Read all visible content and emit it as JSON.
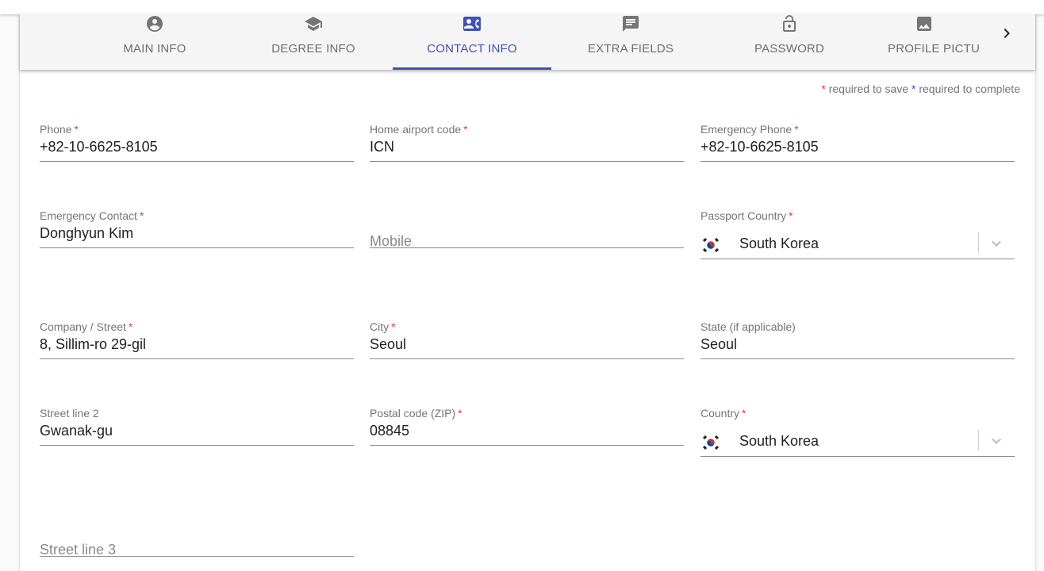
{
  "tabs": [
    {
      "label": "MAIN INFO",
      "icon": "account-circle-icon",
      "active": false
    },
    {
      "label": "DEGREE INFO",
      "icon": "school-icon",
      "active": false
    },
    {
      "label": "CONTACT INFO",
      "icon": "contact-card-icon",
      "active": true
    },
    {
      "label": "EXTRA FIELDS",
      "icon": "chat-message-icon",
      "active": false
    },
    {
      "label": "PASSWORD",
      "icon": "lock-icon",
      "active": false
    },
    {
      "label": "PROFILE PICTU",
      "icon": "image-icon",
      "active": false
    }
  ],
  "legend": {
    "star": "*",
    "save": "required to save",
    "complete": "required to complete"
  },
  "colors": {
    "accent": "#3f51b5",
    "required": "#e53935",
    "label": "#757575",
    "text": "#212121"
  },
  "form": {
    "phone": {
      "label": "Phone",
      "required": "*",
      "value": "+82-10-6625-8105"
    },
    "home_airport": {
      "label": "Home airport code",
      "required": "*",
      "value": "ICN"
    },
    "emergency_phone": {
      "label": "Emergency Phone",
      "required": "*",
      "value": "+82-10-6625-8105"
    },
    "emergency_contact": {
      "label": "Emergency Contact",
      "required": "*",
      "value": "Donghyun Kim"
    },
    "mobile": {
      "placeholder": "Mobile"
    },
    "passport_country": {
      "label": "Passport Country",
      "required": "*",
      "value": "South Korea",
      "flag": "south-korea-flag-icon"
    },
    "company_street": {
      "label": "Company / Street",
      "required": "*",
      "value": "8, Sillim-ro 29-gil"
    },
    "city": {
      "label": "City",
      "required": "*",
      "value": "Seoul"
    },
    "state": {
      "label": "State (if applicable)",
      "value": "Seoul"
    },
    "street_line_2": {
      "label": "Street line 2",
      "value": "Gwanak-gu"
    },
    "postal_code": {
      "label": "Postal code (ZIP)",
      "required": "*",
      "value": "08845"
    },
    "country": {
      "label": "Country",
      "required": "*",
      "value": "South Korea",
      "flag": "south-korea-flag-icon"
    },
    "street_line_3": {
      "placeholder": "Street line 3"
    }
  }
}
